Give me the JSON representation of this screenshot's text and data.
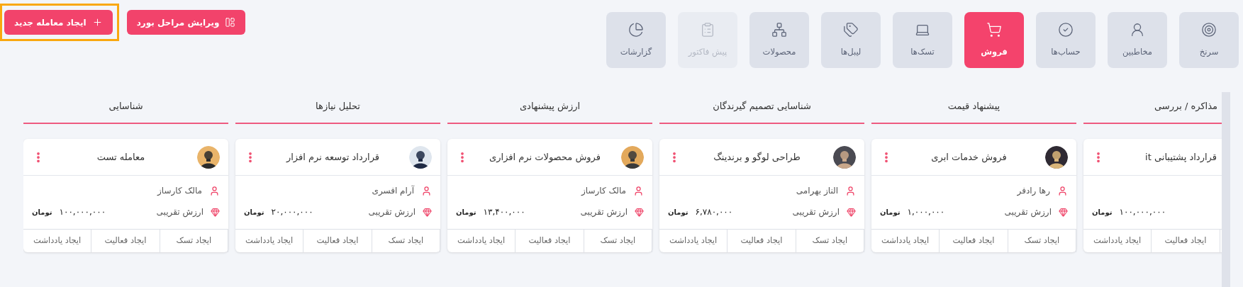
{
  "nav": [
    {
      "label": "سرنخ",
      "selected": false,
      "disabled": false
    },
    {
      "label": "مخاطبین",
      "selected": false,
      "disabled": false
    },
    {
      "label": "حساب‌ها",
      "selected": false,
      "disabled": false
    },
    {
      "label": "فروش",
      "selected": true,
      "disabled": false
    },
    {
      "label": "تسک‌ها",
      "selected": false,
      "disabled": false
    },
    {
      "label": "لیبل‌ها",
      "selected": false,
      "disabled": false
    },
    {
      "label": "محصولات",
      "selected": false,
      "disabled": false
    },
    {
      "label": "پیش فاکتور",
      "selected": false,
      "disabled": true
    },
    {
      "label": "گزارشات",
      "selected": false,
      "disabled": false
    }
  ],
  "header_buttons": [
    {
      "label": "ویرایش مراحل بورد",
      "highlighted": false
    },
    {
      "label": "ایجاد معامله جدید",
      "highlighted": true
    }
  ],
  "board": {
    "columns": [
      {
        "title": "مذاکره / بررسی",
        "cards": [
          {
            "title": "قرارداد پشتیبانی it",
            "amount": "۱۰۰,۰۰۰,۰۰۰",
            "currency": "تومان",
            "actions": [
              "ایجاد فعالیت",
              "ایجاد یادداشت"
            ]
          }
        ]
      },
      {
        "title": "پیشنهاد قیمت",
        "cards": [
          {
            "title": "فروش خدمات ابری",
            "owner": "رها رادفر",
            "value_label": "ارزش تقریبی",
            "amount": "۱,۰۰۰,۰۰۰",
            "currency": "تومان",
            "actions": [
              "ایجاد تسک",
              "ایجاد فعالیت",
              "ایجاد یادداشت"
            ]
          }
        ]
      },
      {
        "title": "شناسایی تصمیم گیرندگان",
        "cards": [
          {
            "title": "طراحی لوگو و برندینگ",
            "owner": "الناز بهرامی",
            "value_label": "ارزش تقریبی",
            "amount": "۶,۷۸۰,۰۰۰",
            "currency": "تومان",
            "actions": [
              "ایجاد تسک",
              "ایجاد فعالیت",
              "ایجاد یادداشت"
            ]
          }
        ]
      },
      {
        "title": "ارزش پیشنهادی",
        "cards": [
          {
            "title": "فروش محصولات نرم افزاری",
            "owner": "مالک کارساز",
            "value_label": "ارزش تقریبی",
            "amount": "۱۳,۴۰۰,۰۰۰",
            "currency": "تومان",
            "actions": [
              "ایجاد تسک",
              "ایجاد فعالیت",
              "ایجاد یادداشت"
            ]
          }
        ]
      },
      {
        "title": "تحلیل نیازها",
        "cards": [
          {
            "title": "قرارداد توسعه نرم افزار",
            "owner": "آرام افسری",
            "value_label": "ارزش تقریبی",
            "amount": "۲۰,۰۰۰,۰۰۰",
            "currency": "تومان",
            "actions": [
              "ایجاد تسک",
              "ایجاد فعالیت",
              "ایجاد یادداشت"
            ]
          }
        ]
      },
      {
        "title": "شناسایی",
        "cards": [
          {
            "title": "معامله تست",
            "owner": "مالک کارساز",
            "value_label": "ارزش تقریبی",
            "amount": "۱۰۰,۰۰۰,۰۰۰",
            "currency": "تومان",
            "actions": [
              "ایجاد تسک",
              "ایجاد فعالیت",
              "ایجاد یادداشت"
            ]
          }
        ]
      }
    ]
  }
}
